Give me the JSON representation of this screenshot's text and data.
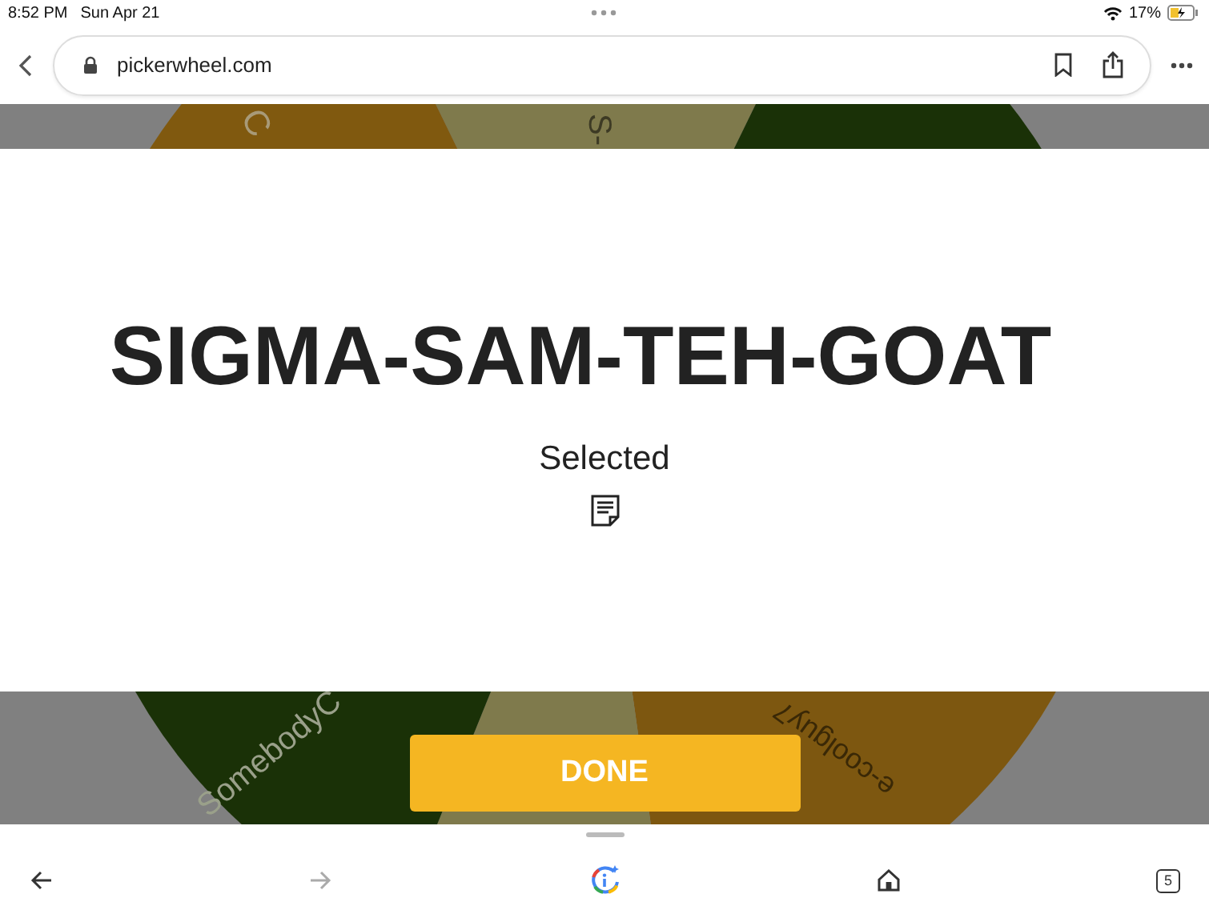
{
  "status_bar": {
    "time": "8:52 PM",
    "date": "Sun Apr 21",
    "battery": "17%"
  },
  "address_bar": {
    "url": "pickerwheel.com"
  },
  "wheel": {
    "labels": [
      {
        "text": "C"
      },
      {
        "text": "S-"
      },
      {
        "text": "SomebodyC"
      },
      {
        "text": "e-coolguy7"
      }
    ]
  },
  "result": {
    "winner": "SIGMA-SAM-TEH-GOAT",
    "caption": "Selected"
  },
  "done_button": "DONE",
  "toolbar": {
    "tab_count": "5"
  }
}
